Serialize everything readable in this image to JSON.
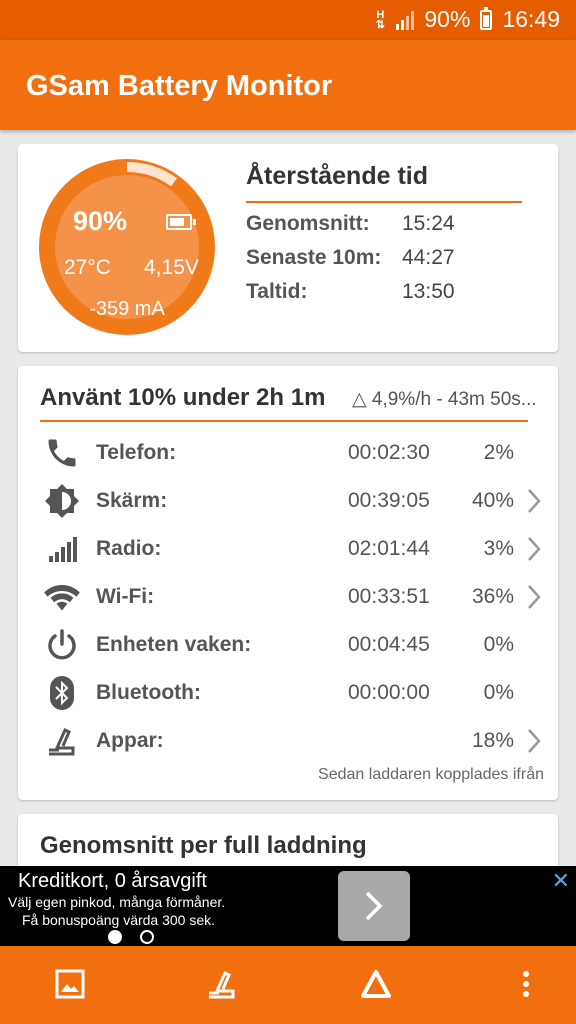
{
  "status_bar": {
    "network_type": "H",
    "battery": "90%",
    "time": "16:49"
  },
  "app_bar": {
    "title": "GSam Battery Monitor"
  },
  "battery_card": {
    "level": "90%",
    "level_fraction": 0.9,
    "temperature": "27°C",
    "voltage": "4,15V",
    "current": "-359 mA",
    "remaining_title": "Återstående tid",
    "rows": [
      {
        "label": "Genomsnitt:",
        "value": "15:24"
      },
      {
        "label": "Senaste 10m:",
        "value": "44:27"
      },
      {
        "label": "Taltid:",
        "value": "13:50"
      }
    ]
  },
  "usage_card": {
    "title": "Använt 10% under 2h 1m",
    "subtitle": "△ 4,9%/h - 43m 50s...",
    "rows": [
      {
        "icon": "phone-icon",
        "label": "Telefon:",
        "time": "00:02:30",
        "percent": "2%",
        "has_chevron": false
      },
      {
        "icon": "brightness-icon",
        "label": "Skärm:",
        "time": "00:39:05",
        "percent": "40%",
        "has_chevron": true
      },
      {
        "icon": "signal-bars-icon",
        "label": "Radio:",
        "time": "02:01:44",
        "percent": "3%",
        "has_chevron": true
      },
      {
        "icon": "wifi-icon",
        "label": "Wi-Fi:",
        "time": "00:33:51",
        "percent": "36%",
        "has_chevron": true
      },
      {
        "icon": "power-icon",
        "label": "Enheten vaken:",
        "time": "00:04:45",
        "percent": "0%",
        "has_chevron": false
      },
      {
        "icon": "bluetooth-icon",
        "label": "Bluetooth:",
        "time": "00:00:00",
        "percent": "0%",
        "has_chevron": false
      },
      {
        "icon": "apps-icon",
        "label": "Appar:",
        "time": "",
        "percent": "18%",
        "has_chevron": true
      }
    ],
    "footer": "Sedan laddaren kopplades ifrån"
  },
  "average_card": {
    "title": "Genomsnitt per full laddning"
  },
  "ad": {
    "title": "Kreditkort, 0 årsavgift",
    "line1": "Välj egen pinkod, många förmåner.",
    "line2": "Få bonuspoäng värda 300 sek.",
    "close_symbol": "✕"
  },
  "colors": {
    "accent": "#f26f0f",
    "status_bar": "#e65c00",
    "gauge_outer": "#f07a1a",
    "gauge_inner": "#f4924a"
  }
}
